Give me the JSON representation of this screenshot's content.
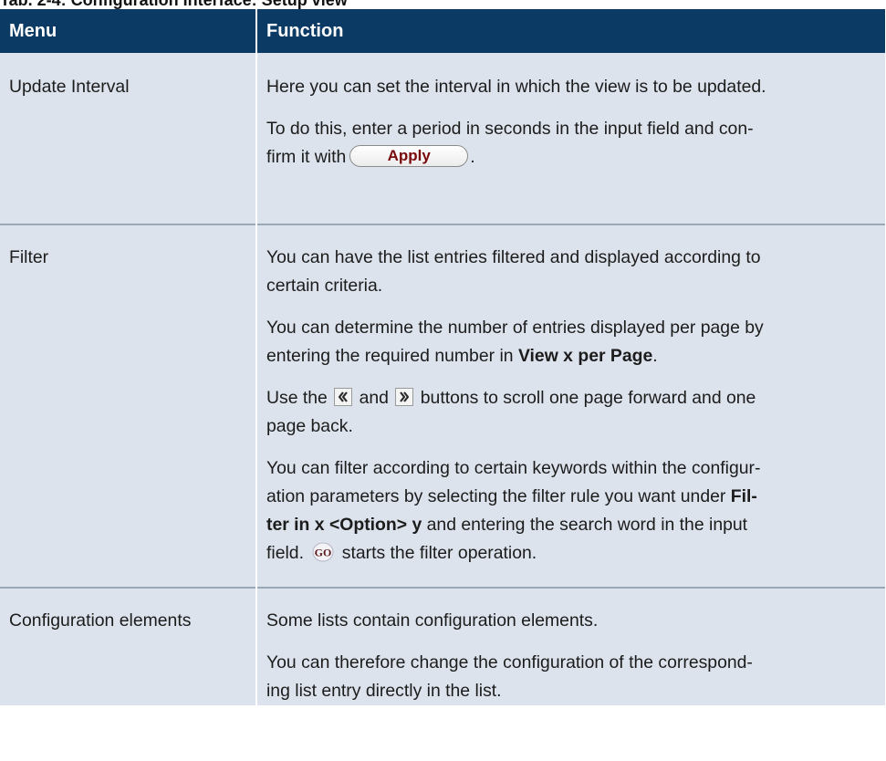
{
  "caption": "Tab. 2-4: Configuration Interface: Setup view",
  "header": {
    "menu": "Menu",
    "function": "Function"
  },
  "rows": [
    {
      "menu": "Update Interval",
      "p1": "Here you can set the interval in which the view is to be updated.",
      "p2_line1": "To do this, enter a period in seconds in the input field and con-",
      "p2_line2_before": "firm it with",
      "apply_label": "Apply",
      "p2_line2_after": "."
    },
    {
      "menu": "Filter",
      "p1_line1": "You can have the list entries filtered and displayed according to",
      "p1_line2": "certain criteria.",
      "p2_line1": "You can determine the number of entries displayed per page by",
      "p2_line2_before": "entering the required number in",
      "p2_bold": "View x per Page",
      "p2_line2_after": ".",
      "p3_before": "Use the",
      "p3_mid": "and",
      "p3_after": "buttons to scroll one page forward and one",
      "p3_line2": "page back.",
      "p4_line1": "You can filter according to certain keywords within the configur-",
      "p4_line2_before": "ation parameters by selecting the filter rule you want under",
      "p4_bold1": "Fil-",
      "p4_bold2": "ter in x <Option> y",
      "p4_line3_after": "and entering the search word in the input",
      "p4_line4_before": "field.",
      "p4_line4_after": "starts the filter operation."
    },
    {
      "menu": "Configuration elements",
      "p1": "Some lists contain configuration elements.",
      "p2_line1": "You can therefore change the configuration of the correspond-",
      "p2_line2": "ing list entry directly in the list."
    }
  ],
  "icons": {
    "apply_button": "apply-button",
    "prev_page": "double-chevron-left-icon",
    "next_page": "double-chevron-right-icon",
    "go_button": "go-icon"
  },
  "colors": {
    "header_bg": "#0b3a64",
    "row_bg": "#dde3ec",
    "apply_text": "#7a0a0a"
  }
}
